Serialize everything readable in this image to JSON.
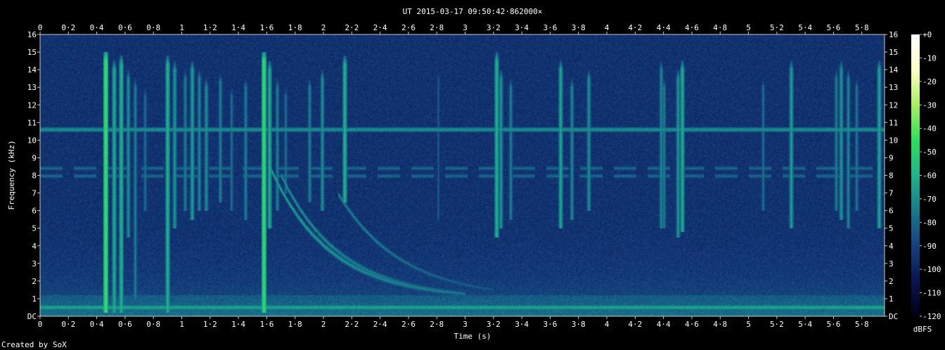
{
  "chart_data": {
    "type": "heatmap",
    "title": "UT 2015-03-17 09:50:42·862000×",
    "xlabel": "Time (s)",
    "ylabel": "Frequency (kHz)",
    "footer": "Created by SoX",
    "colorbar_label": "dBFS",
    "xlim": [
      0,
      5.96
    ],
    "ylim": [
      0,
      16
    ],
    "x_ticks": [
      {
        "v": 0,
        "label": "0"
      },
      {
        "v": 0.2,
        "label": "0·2"
      },
      {
        "v": 0.4,
        "label": "0·4"
      },
      {
        "v": 0.6,
        "label": "0·6"
      },
      {
        "v": 0.8,
        "label": "0·8"
      },
      {
        "v": 1,
        "label": "1"
      },
      {
        "v": 1.2,
        "label": "1·2"
      },
      {
        "v": 1.4,
        "label": "1·4"
      },
      {
        "v": 1.6,
        "label": "1·6"
      },
      {
        "v": 1.8,
        "label": "1·8"
      },
      {
        "v": 2,
        "label": "2"
      },
      {
        "v": 2.2,
        "label": "2·2"
      },
      {
        "v": 2.4,
        "label": "2·4"
      },
      {
        "v": 2.6,
        "label": "2·6"
      },
      {
        "v": 2.8,
        "label": "2·8"
      },
      {
        "v": 3,
        "label": "3"
      },
      {
        "v": 3.2,
        "label": "3·2"
      },
      {
        "v": 3.4,
        "label": "3·4"
      },
      {
        "v": 3.6,
        "label": "3·6"
      },
      {
        "v": 3.8,
        "label": "3·8"
      },
      {
        "v": 4,
        "label": "4"
      },
      {
        "v": 4.2,
        "label": "4·2"
      },
      {
        "v": 4.4,
        "label": "4·4"
      },
      {
        "v": 4.6,
        "label": "4·6"
      },
      {
        "v": 4.8,
        "label": "4·8"
      },
      {
        "v": 5,
        "label": "5"
      },
      {
        "v": 5.2,
        "label": "5·2"
      },
      {
        "v": 5.4,
        "label": "5·4"
      },
      {
        "v": 5.6,
        "label": "5·6"
      },
      {
        "v": 5.8,
        "label": "5·8"
      }
    ],
    "y_ticks": [
      {
        "v": 0,
        "label": "DC"
      },
      {
        "v": 1,
        "label": "1"
      },
      {
        "v": 2,
        "label": "2"
      },
      {
        "v": 3,
        "label": "3"
      },
      {
        "v": 4,
        "label": "4"
      },
      {
        "v": 5,
        "label": "5"
      },
      {
        "v": 6,
        "label": "6"
      },
      {
        "v": 7,
        "label": "7"
      },
      {
        "v": 8,
        "label": "8"
      },
      {
        "v": 9,
        "label": "9"
      },
      {
        "v": 10,
        "label": "10"
      },
      {
        "v": 11,
        "label": "11"
      },
      {
        "v": 12,
        "label": "12"
      },
      {
        "v": 13,
        "label": "13"
      },
      {
        "v": 14,
        "label": "14"
      },
      {
        "v": 15,
        "label": "15"
      },
      {
        "v": 16,
        "label": "16"
      }
    ],
    "colorbar_ticks": [
      {
        "v": 0,
        "label": "+0"
      },
      {
        "v": -10,
        "label": "-10"
      },
      {
        "v": -20,
        "label": "-20"
      },
      {
        "v": -30,
        "label": "-30"
      },
      {
        "v": -40,
        "label": "-40"
      },
      {
        "v": -50,
        "label": "-50"
      },
      {
        "v": -60,
        "label": "-60"
      },
      {
        "v": -70,
        "label": "-70"
      },
      {
        "v": -80,
        "label": "-80"
      },
      {
        "v": -90,
        "label": "-90"
      },
      {
        "v": -100,
        "label": "-100"
      },
      {
        "v": -110,
        "label": "-110"
      },
      {
        "v": -120,
        "label": "-120"
      }
    ],
    "colorbar_range": [
      -120,
      0
    ],
    "colormap": [
      "#000010",
      "#0a1452",
      "#15417e",
      "#177a8c",
      "#1fb48a",
      "#2de05a",
      "#a8f060",
      "#ffffc8",
      "#ffffff"
    ],
    "background_level_dbfs": -95,
    "horizontal_tones": [
      {
        "f_khz": 10.6,
        "level_dbfs": -68
      },
      {
        "f_khz": 8.4,
        "level_dbfs": -78
      },
      {
        "f_khz": 8.0,
        "level_dbfs": -78
      },
      {
        "f_khz": 0.5,
        "level_dbfs": -62
      }
    ],
    "impulses": [
      {
        "t": 0.46,
        "fmin": 0.2,
        "fmax": 15.0,
        "level_dbfs": -42
      },
      {
        "t": 0.52,
        "fmin": 0.2,
        "fmax": 14.5,
        "level_dbfs": -60
      },
      {
        "t": 0.57,
        "fmin": 0.2,
        "fmax": 14.8,
        "level_dbfs": -58
      },
      {
        "t": 0.62,
        "fmin": 4.5,
        "fmax": 14.0,
        "level_dbfs": -68
      },
      {
        "t": 0.67,
        "fmin": 1.0,
        "fmax": 13.5,
        "level_dbfs": -72
      },
      {
        "t": 0.74,
        "fmin": 6.0,
        "fmax": 13.0,
        "level_dbfs": -76
      },
      {
        "t": 0.9,
        "fmin": 0.2,
        "fmax": 14.8,
        "level_dbfs": -58
      },
      {
        "t": 0.95,
        "fmin": 5.0,
        "fmax": 14.5,
        "level_dbfs": -66
      },
      {
        "t": 1.02,
        "fmin": 6.0,
        "fmax": 14.0,
        "level_dbfs": -72
      },
      {
        "t": 1.07,
        "fmin": 5.5,
        "fmax": 14.5,
        "level_dbfs": -64
      },
      {
        "t": 1.12,
        "fmin": 6.0,
        "fmax": 14.0,
        "level_dbfs": -70
      },
      {
        "t": 1.17,
        "fmin": 6.0,
        "fmax": 13.5,
        "level_dbfs": -68
      },
      {
        "t": 1.27,
        "fmin": 6.5,
        "fmax": 13.8,
        "level_dbfs": -72
      },
      {
        "t": 1.35,
        "fmin": 6.0,
        "fmax": 13.0,
        "level_dbfs": -76
      },
      {
        "t": 1.45,
        "fmin": 5.5,
        "fmax": 13.5,
        "level_dbfs": -72
      },
      {
        "t": 1.58,
        "fmin": 0.2,
        "fmax": 15.0,
        "level_dbfs": -44
      },
      {
        "t": 1.62,
        "fmin": 5.0,
        "fmax": 14.5,
        "level_dbfs": -60
      },
      {
        "t": 1.67,
        "fmin": 6.0,
        "fmax": 13.5,
        "level_dbfs": -72
      },
      {
        "t": 1.73,
        "fmin": 7.0,
        "fmax": 13.0,
        "level_dbfs": -76
      },
      {
        "t": 1.9,
        "fmin": 6.5,
        "fmax": 13.5,
        "level_dbfs": -72
      },
      {
        "t": 1.99,
        "fmin": 6.0,
        "fmax": 14.0,
        "level_dbfs": -68
      },
      {
        "t": 2.15,
        "fmin": 6.5,
        "fmax": 14.8,
        "level_dbfs": -58
      },
      {
        "t": 2.81,
        "fmin": 5.5,
        "fmax": 14.0,
        "level_dbfs": -82
      },
      {
        "t": 3.22,
        "fmin": 4.5,
        "fmax": 15.0,
        "level_dbfs": -58
      },
      {
        "t": 3.25,
        "fmin": 5.0,
        "fmax": 14.0,
        "level_dbfs": -66
      },
      {
        "t": 3.32,
        "fmin": 5.5,
        "fmax": 13.5,
        "level_dbfs": -72
      },
      {
        "t": 3.67,
        "fmin": 5.0,
        "fmax": 14.5,
        "level_dbfs": -62
      },
      {
        "t": 3.75,
        "fmin": 5.5,
        "fmax": 13.5,
        "level_dbfs": -70
      },
      {
        "t": 3.87,
        "fmin": 6.0,
        "fmax": 14.0,
        "level_dbfs": -68
      },
      {
        "t": 4.38,
        "fmin": 5.0,
        "fmax": 14.5,
        "level_dbfs": -70
      },
      {
        "t": 4.4,
        "fmin": 5.0,
        "fmax": 13.5,
        "level_dbfs": -72
      },
      {
        "t": 4.5,
        "fmin": 4.5,
        "fmax": 14.0,
        "level_dbfs": -66
      },
      {
        "t": 4.53,
        "fmin": 4.8,
        "fmax": 14.5,
        "level_dbfs": -60
      },
      {
        "t": 5.1,
        "fmin": 6.0,
        "fmax": 13.5,
        "level_dbfs": -76
      },
      {
        "t": 5.3,
        "fmin": 5.0,
        "fmax": 14.5,
        "level_dbfs": -64
      },
      {
        "t": 5.62,
        "fmin": 6.0,
        "fmax": 14.0,
        "level_dbfs": -72
      },
      {
        "t": 5.65,
        "fmin": 5.5,
        "fmax": 14.5,
        "level_dbfs": -66
      },
      {
        "t": 5.7,
        "fmin": 5.0,
        "fmax": 14.0,
        "level_dbfs": -70
      },
      {
        "t": 5.76,
        "fmin": 6.0,
        "fmax": 13.5,
        "level_dbfs": -74
      },
      {
        "t": 5.92,
        "fmin": 5.0,
        "fmax": 14.5,
        "level_dbfs": -62
      }
    ],
    "dispersed_sweeps": [
      {
        "t0": 1.62,
        "f0": 8.5,
        "f_end": 1.0,
        "tau": 0.42,
        "t_end": 3.0,
        "level_dbfs": -62
      },
      {
        "t0": 1.7,
        "f0": 8.0,
        "f_end": 1.0,
        "tau": 0.42,
        "t_end": 3.0,
        "level_dbfs": -66
      },
      {
        "t0": 2.1,
        "f0": 7.0,
        "f_end": 1.0,
        "tau": 0.45,
        "t_end": 3.2,
        "level_dbfs": -70
      }
    ]
  }
}
